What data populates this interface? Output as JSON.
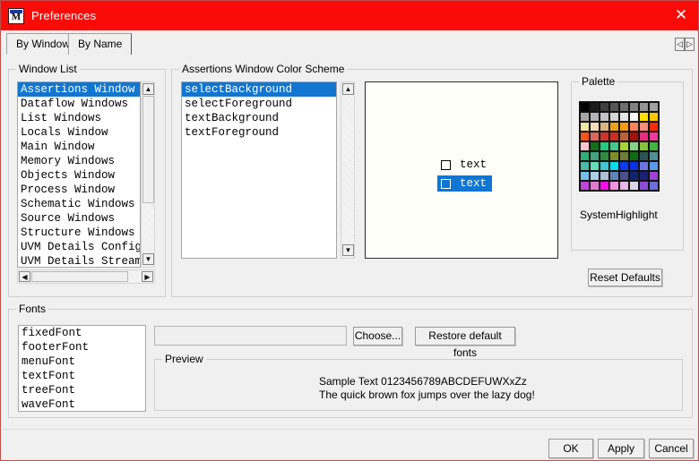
{
  "titlebar": {
    "title": "Preferences",
    "icon": "modelsim-m-icon",
    "close_label": "✕"
  },
  "tabs": [
    {
      "label": "By Window",
      "selected": true
    },
    {
      "label": "By Name",
      "selected": false
    }
  ],
  "tab_scroll": {
    "left": "◁",
    "right": "▷"
  },
  "window_list": {
    "group_label": "Window List",
    "items": [
      "Assertions Window",
      "Dataflow Windows",
      "List Windows",
      "Locals Window",
      "Main Window",
      "Memory Windows",
      "Objects Window",
      "Process Window",
      "Schematic Windows",
      "Source Windows",
      "Structure Windows",
      "UVM Details ConfigD",
      "UVM Details Stream"
    ],
    "selected_index": 0,
    "scroll_up": "▲",
    "scroll_down": "▼",
    "scroll_left": "◀",
    "scroll_right": "▶"
  },
  "color_scheme": {
    "group_label": "Assertions Window Color Scheme",
    "items": [
      "selectBackground",
      "selectForeground",
      "textBackground",
      "textForeground"
    ],
    "selected_index": 0,
    "scroll_up": "▲",
    "scroll_down": "▼"
  },
  "preview": {
    "rows": [
      {
        "label": "text",
        "highlighted": false
      },
      {
        "label": "text",
        "highlighted": true
      }
    ],
    "background": "#fffffa",
    "highlight_color": "#1076d1"
  },
  "palette": {
    "group_label": "Palette",
    "selected_name": "SystemHighlight",
    "colors": [
      [
        "#000000",
        "#1c1c1c",
        "#404040",
        "#565656",
        "#6e6e6e",
        "#828282",
        "#949494",
        "#a0a0a0"
      ],
      [
        "#a6a6a6",
        "#b4b4b4",
        "#c4c4c4",
        "#d4d4d4",
        "#e6e6e6",
        "#fbfbfb",
        "#ffe000",
        "#fcc800"
      ],
      [
        "#eee89a",
        "#f4dcba",
        "#dbb380",
        "#e8a117",
        "#f99a10",
        "#fc8457",
        "#fc8a79",
        "#fe2b0a"
      ],
      [
        "#fb5317",
        "#e0655c",
        "#cf3327",
        "#cb2e22",
        "#b8613a",
        "#a8100a",
        "#e62c7e",
        "#f0399b"
      ],
      [
        "#fcc6cf",
        "#127018",
        "#1fcc7e",
        "#44c98a",
        "#a8d432",
        "#83d287",
        "#83c238",
        "#3cb63c"
      ],
      [
        "#2fae75",
        "#3fa381",
        "#2e8c3e",
        "#7e8c24",
        "#6f7c34",
        "#106b14",
        "#2c5252",
        "#4e8f97"
      ],
      [
        "#4cb9a6",
        "#5ee0bb",
        "#3fc8d6",
        "#00ddef",
        "#0a3bf0",
        "#0b30e4",
        "#6c74e2",
        "#5c9ae8"
      ],
      [
        "#73c1ea",
        "#a9cfe8",
        "#aebfd6",
        "#5e84bb",
        "#4b4f8c",
        "#11246f",
        "#1a2076",
        "#9c42d6"
      ],
      [
        "#c145d6",
        "#e07ad0",
        "#f80ce8",
        "#f293e2",
        "#e4b7e4",
        "#dbd4e6",
        "#8b4dd6",
        "#6e6ed8"
      ]
    ]
  },
  "reset_button": {
    "label": "Reset Defaults"
  },
  "fonts": {
    "group_label": "Fonts",
    "items": [
      "fixedFont",
      "footerFont",
      "menuFont",
      "textFont",
      "treeFont",
      "waveFont"
    ],
    "selected_index": -1,
    "font_field_value": "",
    "choose_label": "Choose...",
    "restore_label": "Restore default fonts",
    "preview_group_label": "Preview",
    "preview_line1": "Sample Text 0123456789ABCDEFUWXxZz",
    "preview_line2": "The quick brown fox jumps over the lazy dog!"
  },
  "footer": {
    "ok": "OK",
    "apply": "Apply",
    "cancel": "Cancel"
  }
}
